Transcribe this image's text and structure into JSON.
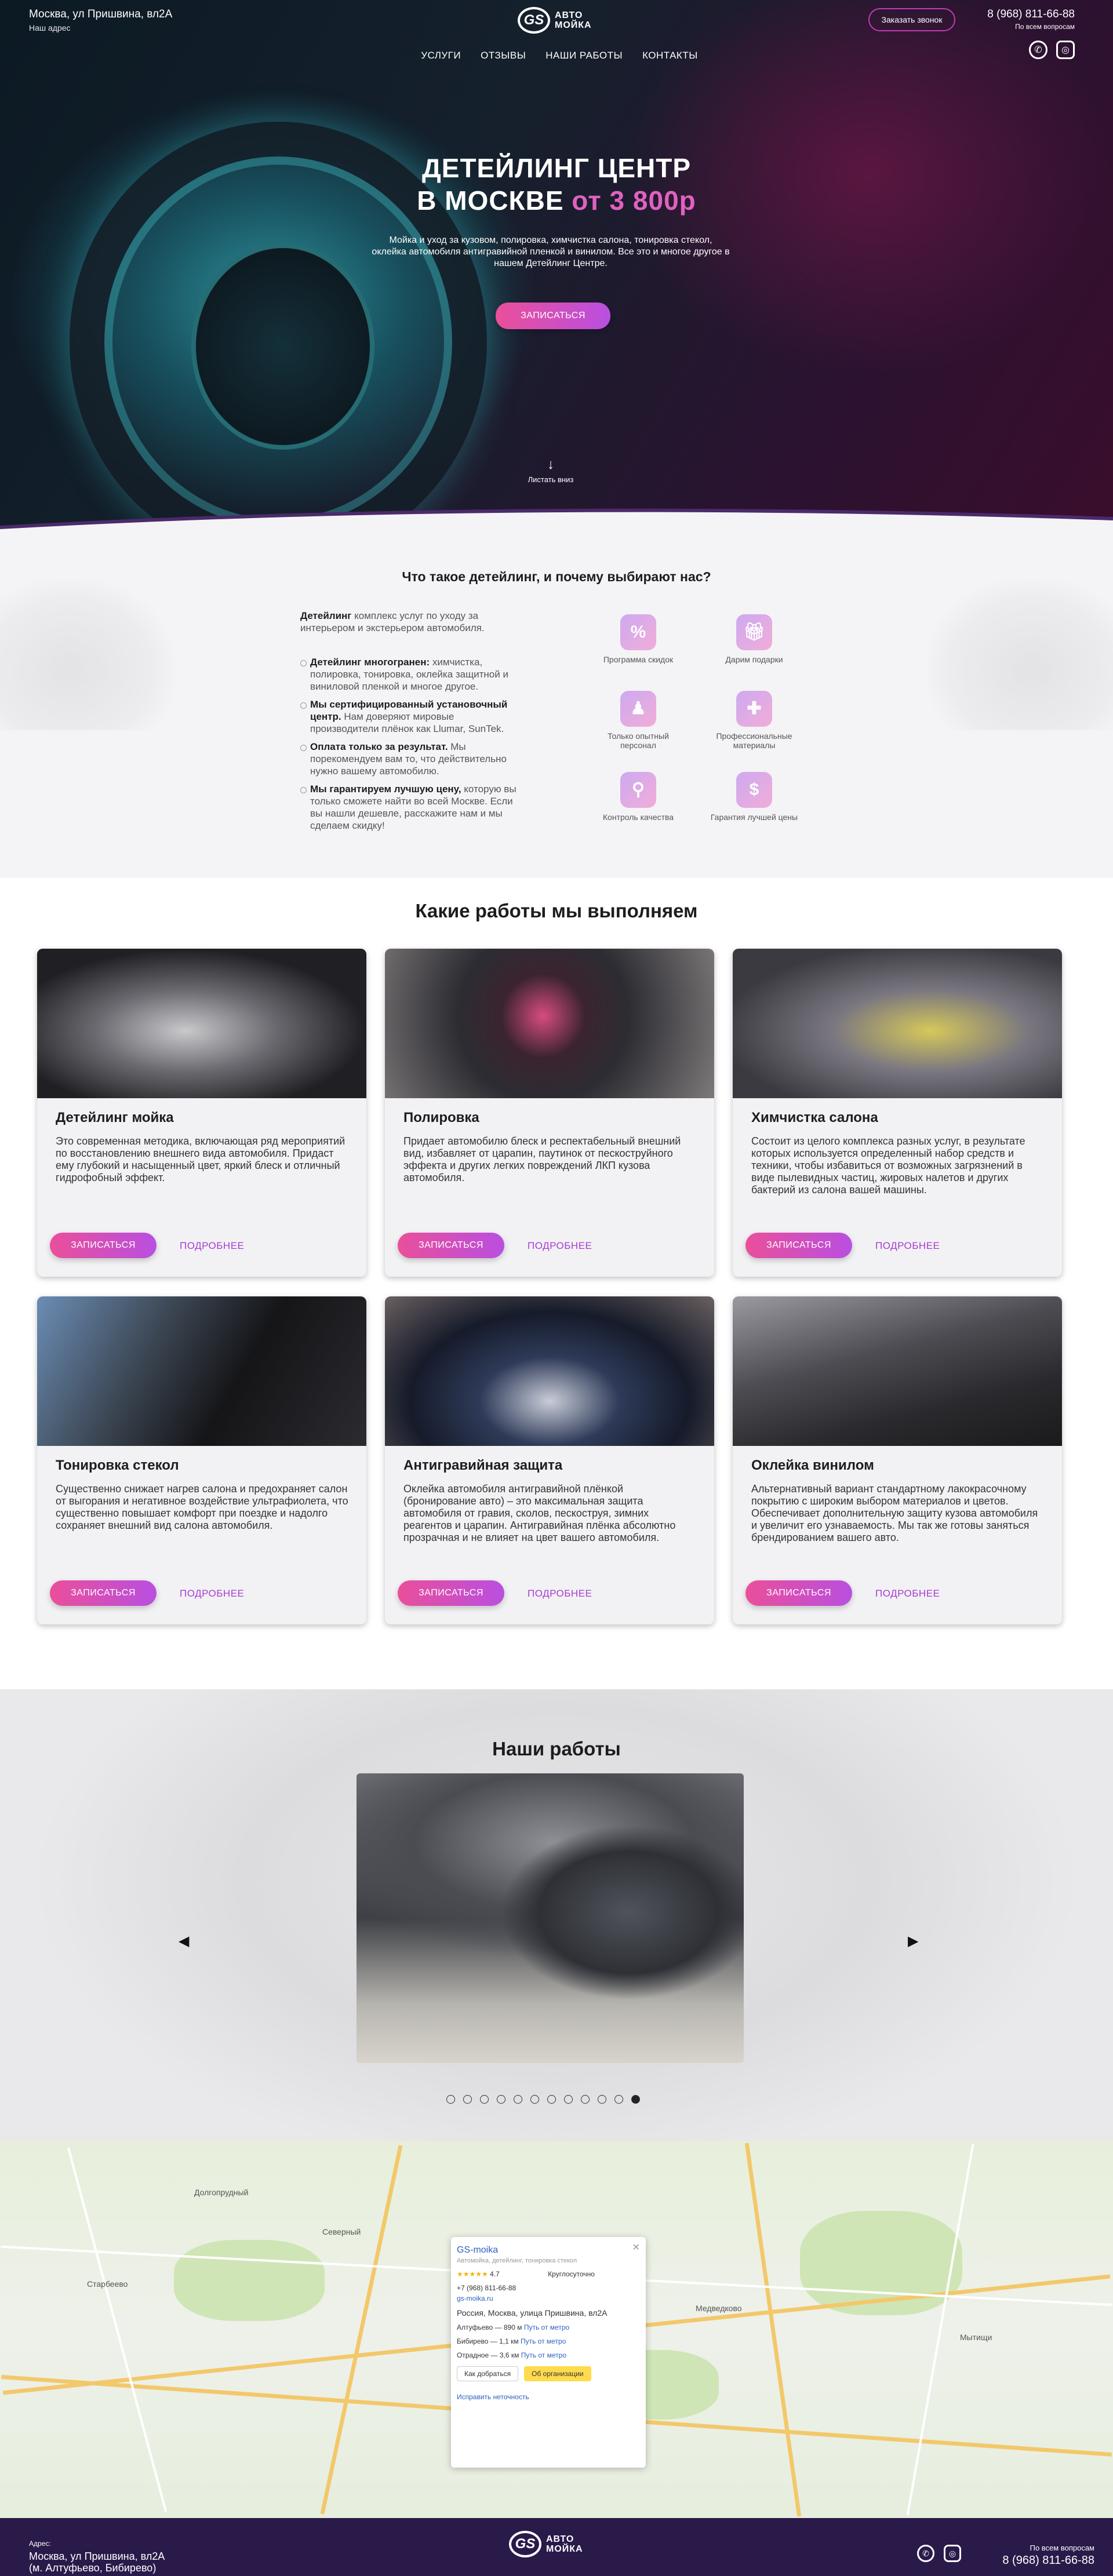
{
  "header": {
    "address": "Москва, ул Пришвина, вл2А",
    "address_sub": "Наш адрес",
    "logo_mark": "GS",
    "logo_text_1": "АВТО",
    "logo_text_2": "МОЙКА",
    "call_button": "Заказать звонок",
    "phone": "8 (968) 811-66-88",
    "phone_sub": "По всем вопросам",
    "nav": [
      "УСЛУГИ",
      "ОТЗЫВЫ",
      "НАШИ РАБОТЫ",
      "КОНТАКТЫ"
    ]
  },
  "hero": {
    "title_1": "ДЕТЕЙЛИНГ ЦЕНТР",
    "title_2": "В МОСКВЕ ",
    "title_accent": "от 3 800р",
    "description": "Мойка и уход за кузовом, полировка, химчистка салона, тонировка стекол, оклейка автомобиля антигравийной пленкой и винилом. Все это и многое другое в нашем Детейлинг Центре.",
    "button": "ЗАПИСАТЬСЯ",
    "scroll": "Листать вниз"
  },
  "why": {
    "title": "Что такое детейлинг, и почему выбирают нас?",
    "intro_bold": "Детейлинг",
    "intro_text": " комплекс услуг по уходу за интерьером и экстерьером автомобиля.",
    "points": [
      {
        "bold": "Детейлинг многогранен:",
        "text": " химчистка, полировка, тонировка, оклейка защитной и виниловой пленкой и многое другое."
      },
      {
        "bold": "Мы сертифицированный установочный центр.",
        "text": " Нам доверяют мировые производители плёнок как Llumar, SunTek."
      },
      {
        "bold": "Оплата только за результат.",
        "text": " Мы порекомендуем вам то, что действительно нужно вашему автомобилю."
      },
      {
        "bold": "Мы гарантируем лучшую цену,",
        "text": " которую вы только сможете найти во всей Москве. Если вы нашли дешевле, расскажите нам и мы сделаем скидку!"
      }
    ],
    "features": [
      "Программа скидок",
      "Дарим подарки",
      "Только опытный персонал",
      "Профессиональные материалы",
      "Контроль качества",
      "Гарантия лучшей цены"
    ]
  },
  "services": {
    "title": "Какие работы мы выполняем",
    "book": "ЗАПИСАТЬСЯ",
    "more": "ПОДРОБНЕЕ",
    "items": [
      {
        "title": "Детейлинг мойка",
        "text": "Это современная методика, включающая ряд мероприятий по восстановлению внешнего вида автомобиля. Придаст ему глубокий и насыщенный цвет, яркий блеск и отличный гидрофобный эффект."
      },
      {
        "title": "Полировка",
        "text": "Придает автомобилю блеск и респектабельный внешний вид, избавляет от царапин, паутинок от пескоструйного эффекта и других легких повреждений ЛКП кузова автомобиля."
      },
      {
        "title": "Химчистка салона",
        "text": "Состоит из целого комплекса разных услуг, в результате которых используется определенный набор средств и техники, чтобы избавиться от возможных загрязнений в виде пылевидных частиц, жировых налетов и других бактерий из салона вашей машины."
      },
      {
        "title": "Тонировка стекол",
        "text": "Существенно снижает нагрев салона и предохраняет салон от выгорания и негативное воздействие ультрафиолета, что существенно повышает комфорт при поездке и надолго сохраняет внешний вид салона автомобиля."
      },
      {
        "title": "Антигравийная защита",
        "text": "Оклейка автомобиля антигравийной плёнкой (бронирование авто) – это максимальная защита автомобиля от гравия, сколов, пескоструя, зимних реагентов и царапин. Антигравийная плёнка абсолютно прозрачная и не влияет на цвет вашего автомобиля."
      },
      {
        "title": "Оклейка винилом",
        "text": "Альтернативный вариант стандартному лакокрасочному покрытию с широким выбором материалов и цветов. Обеспечивает дополнительную защиту кузова автомобиля и увеличит его узнаваемость. Мы так же готовы заняться брендированием вашего авто."
      }
    ]
  },
  "works": {
    "title": "Наши работы",
    "prev": "◀",
    "next": "▶",
    "slides_total": 12,
    "active_slide": 12
  },
  "map": {
    "labels": [
      "Долгопрудный",
      "Мытищи",
      "Старбеево",
      "Северный",
      "Медведково"
    ],
    "popup": {
      "title": "GS-moika",
      "category": "Автомойка, детейлинг, тонировка стекол",
      "rating": "4.7",
      "stars": "★★★★★",
      "hours": "Круглосуточно",
      "phone": "+7 (968) 811-66-88",
      "site": "gs-moika.ru",
      "address": "Россия, Москва, улица Пришвина, вл2А",
      "metro": [
        {
          "name": "Алтуфьево — 890 м",
          "link": "Путь от метро"
        },
        {
          "name": "Бибирево — 1,1 км",
          "link": "Путь от метро"
        },
        {
          "name": "Отрадное — 3,6 км",
          "link": "Путь от метро"
        }
      ],
      "route": "Как добраться",
      "about": "Об организации",
      "fix": "Исправить неточность",
      "close": "✕"
    }
  },
  "footer": {
    "address_sub": "Адрес:",
    "address_1": "Москва, ул Пришвина, вл2А",
    "address_2": "(м. Алтуфьево, Бибирево)",
    "phone_sub": "По всем вопросам",
    "phone": "8 (968) 811-66-88"
  },
  "colors": {
    "accent": "#e061c0",
    "button_from": "#ea4f9a",
    "button_to": "#b94fe0",
    "footer": "#2a1a4a"
  }
}
